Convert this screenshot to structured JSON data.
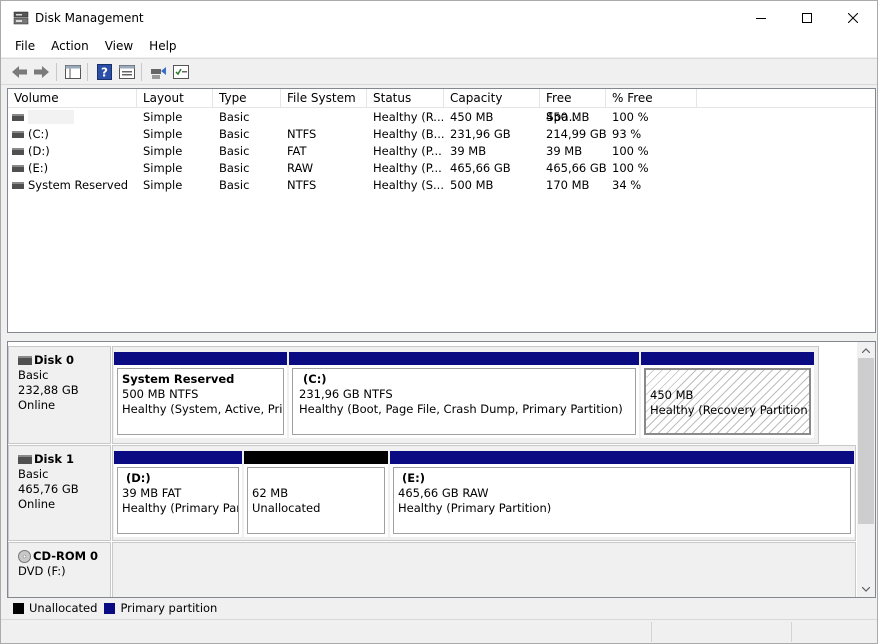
{
  "window": {
    "title": "Disk Management"
  },
  "menu": [
    "File",
    "Action",
    "View",
    "Help"
  ],
  "toolbar": {
    "icons": [
      "back-arrow-icon",
      "forward-arrow-icon",
      "console-tree-icon",
      "help-icon",
      "properties-icon",
      "rescan-icon",
      "checklist-icon"
    ]
  },
  "volume_list": {
    "columns": [
      "Volume",
      "Layout",
      "Type",
      "File System",
      "Status",
      "Capacity",
      "Free Spa...",
      "% Free"
    ],
    "rows": [
      {
        "volume": "",
        "layout": "Simple",
        "type": "Basic",
        "fs": "",
        "status": "Healthy (R...",
        "capacity": "450 MB",
        "free": "450 MB",
        "pct": "100 %"
      },
      {
        "volume": "(C:)",
        "layout": "Simple",
        "type": "Basic",
        "fs": "NTFS",
        "status": "Healthy (B...",
        "capacity": "231,96 GB",
        "free": "214,99 GB",
        "pct": "93 %"
      },
      {
        "volume": "(D:)",
        "layout": "Simple",
        "type": "Basic",
        "fs": "FAT",
        "status": "Healthy (P...",
        "capacity": "39 MB",
        "free": "39 MB",
        "pct": "100 %"
      },
      {
        "volume": "(E:)",
        "layout": "Simple",
        "type": "Basic",
        "fs": "RAW",
        "status": "Healthy (P...",
        "capacity": "465,66 GB",
        "free": "465,66 GB",
        "pct": "100 %"
      },
      {
        "volume": "System Reserved",
        "layout": "Simple",
        "type": "Basic",
        "fs": "NTFS",
        "status": "Healthy (S...",
        "capacity": "500 MB",
        "free": "170 MB",
        "pct": "34 %"
      }
    ]
  },
  "disks": [
    {
      "name": "Disk 0",
      "type": "Basic",
      "size": "232,88 GB",
      "state": "Online",
      "partitions": [
        {
          "name": "System Reserved",
          "line1": "500 MB NTFS",
          "line2": "Healthy (System, Active, Primary Partition)"
        },
        {
          "name": "(C:)",
          "line1": "231,96 GB NTFS",
          "line2": "Healthy (Boot, Page File, Crash Dump, Primary Partition)"
        },
        {
          "name": "",
          "line1": "450 MB",
          "line2": "Healthy (Recovery Partition)"
        }
      ]
    },
    {
      "name": "Disk 1",
      "type": "Basic",
      "size": "465,76 GB",
      "state": "Online",
      "partitions": [
        {
          "name": "(D:)",
          "line1": "39 MB FAT",
          "line2": "Healthy (Primary Partition)"
        },
        {
          "name": "",
          "line1": "62 MB",
          "line2": "Unallocated"
        },
        {
          "name": "(E:)",
          "line1": "465,66 GB RAW",
          "line2": "Healthy (Primary Partition)"
        }
      ]
    },
    {
      "name": "CD-ROM 0",
      "type": "DVD (F:)"
    }
  ],
  "legend": [
    {
      "label": "Unallocated",
      "color": "#000000"
    },
    {
      "label": "Primary partition",
      "color": "#0a0a82"
    }
  ],
  "colors": {
    "primary": "#0a0a82",
    "unallocated": "#000000"
  }
}
